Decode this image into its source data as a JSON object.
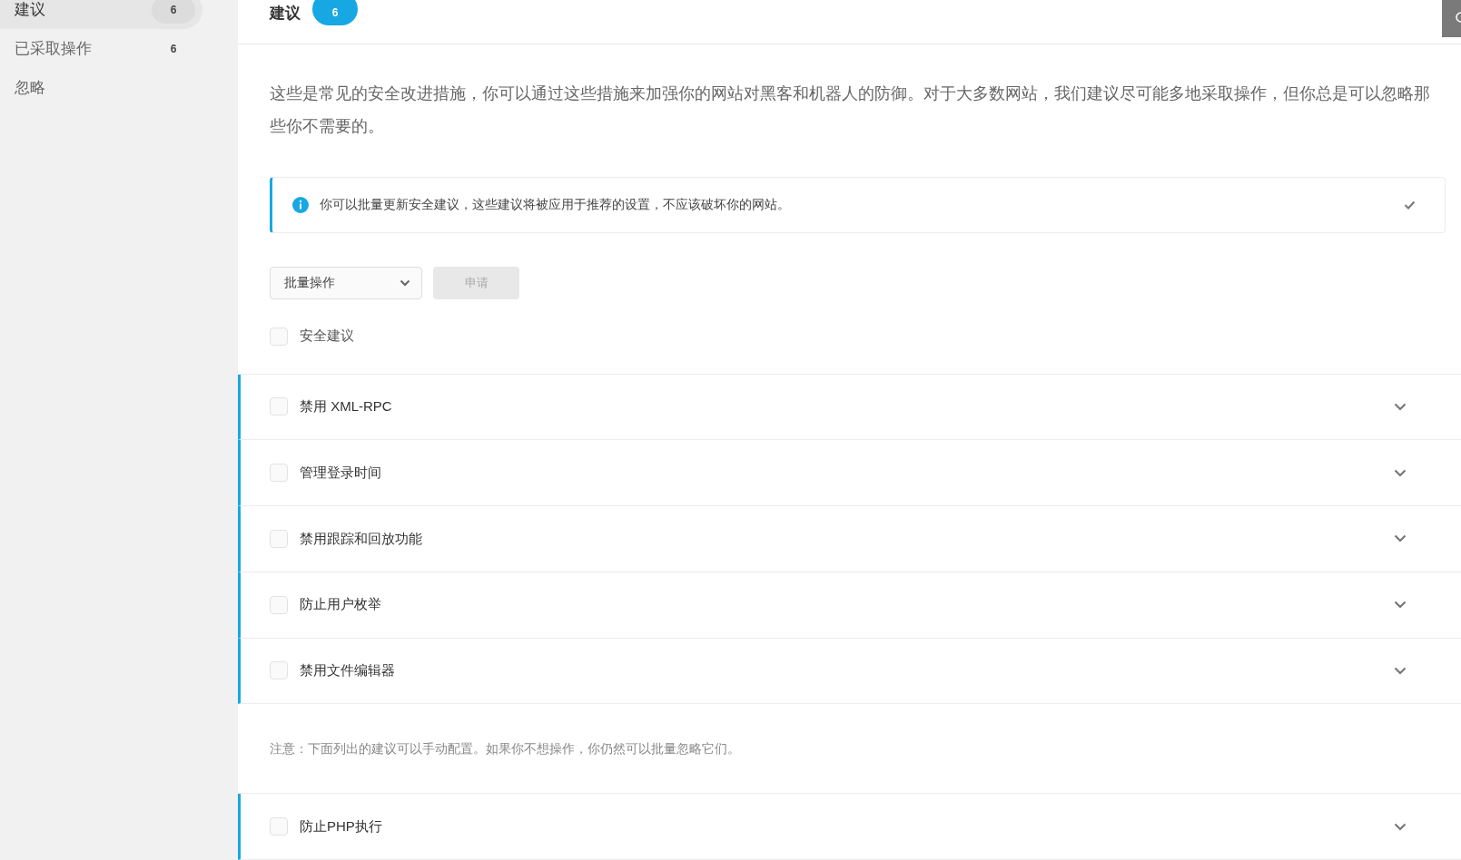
{
  "sidebar": {
    "items": [
      {
        "label": "建议",
        "count": "6",
        "selected": true
      },
      {
        "label": "已采取操作",
        "count": "6",
        "selected": false
      },
      {
        "label": "忽略",
        "selected": false
      }
    ]
  },
  "header": {
    "title": "建议",
    "badge": "6"
  },
  "intro": "这些是常见的安全改进措施，你可以通过这些措施来加强你的网站对黑客和机器人的防御。对于大多数网站，我们建议尽可能多地采取操作，但你总是可以忽略那些你不需要的。",
  "notice": {
    "text": "你可以批量更新安全建议，这些建议将被应用于推荐的设置，不应该破坏你的网站。"
  },
  "bulk": {
    "select": "批量操作",
    "button": "申请",
    "button_disabled": true
  },
  "select_all": {
    "label": "安全建议",
    "checked": false
  },
  "rows": [
    {
      "label": "禁用 XML-RPC",
      "checked": false
    },
    {
      "label": "管理登录时间",
      "checked": false
    },
    {
      "label": "禁用跟踪和回放功能",
      "checked": false
    },
    {
      "label": "防止用户枚举",
      "checked": false
    },
    {
      "label": "禁用文件编辑器",
      "checked": false
    }
  ],
  "note": "注意：下面列出的建议可以手动配置。如果你不想操作，你仍然可以批量忽略它们。",
  "manual_rows": [
    {
      "label": "防止PHP执行",
      "checked": false
    }
  ]
}
